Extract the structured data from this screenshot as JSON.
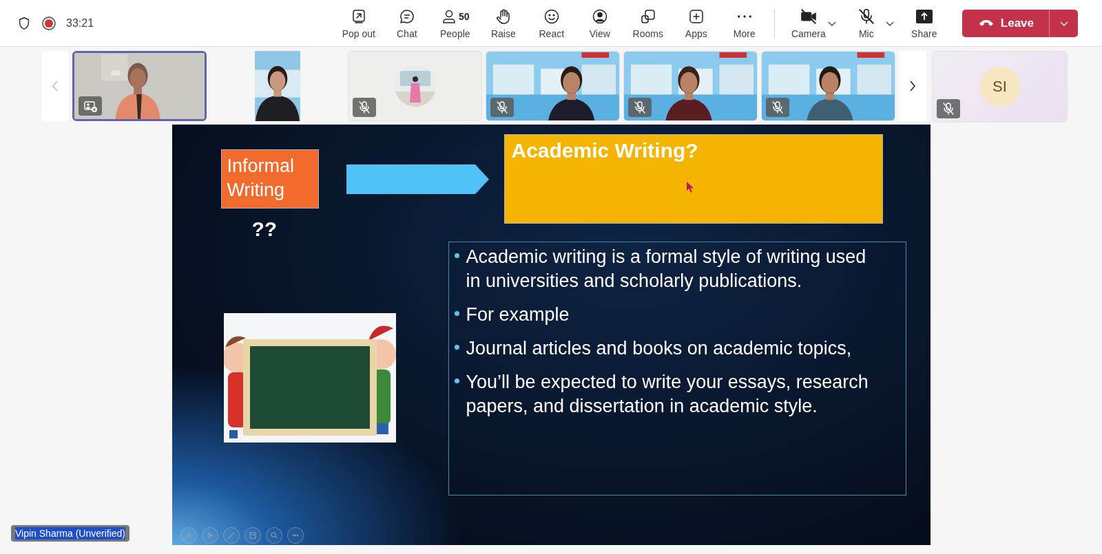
{
  "meeting": {
    "recording": true,
    "timer": "33:21"
  },
  "toolbar": [
    {
      "label": "Pop out"
    },
    {
      "label": "Chat"
    },
    {
      "label": "People",
      "count": "50"
    },
    {
      "label": "Raise"
    },
    {
      "label": "React"
    },
    {
      "label": "View"
    },
    {
      "label": "Rooms"
    },
    {
      "label": "Apps"
    },
    {
      "label": "More"
    }
  ],
  "devices": [
    {
      "label": "Camera",
      "on": false
    },
    {
      "label": "Mic",
      "on": false
    }
  ],
  "share": {
    "label": "Share"
  },
  "leave": {
    "label": "Leave"
  },
  "participants": [
    {
      "kind": "video",
      "selected": true,
      "muted": false,
      "spotlight": true
    },
    {
      "kind": "portrait_video",
      "selected": false,
      "muted": false,
      "spotlight": false
    },
    {
      "kind": "profile_photo",
      "selected": false,
      "muted": true,
      "spotlight": false
    },
    {
      "kind": "video",
      "selected": false,
      "muted": true,
      "spotlight": false
    },
    {
      "kind": "video",
      "selected": false,
      "muted": true,
      "spotlight": false
    },
    {
      "kind": "video",
      "selected": false,
      "muted": true,
      "spotlight": false
    }
  ],
  "side_tile": {
    "initials": "SI",
    "muted": true
  },
  "slide": {
    "informal_label": "Informal Writing",
    "question": "??",
    "title": "Academic Writing?",
    "bullets": [
      "Academic writing is a formal style of writing used in universities and scholarly publications.",
      "For example",
      "Journal articles and books on academic topics,",
      "You’ll be expected to write your essays, research papers, and dissertation in academic style."
    ]
  },
  "presenter": {
    "name": "Vipin Sharma (Unverified)"
  }
}
